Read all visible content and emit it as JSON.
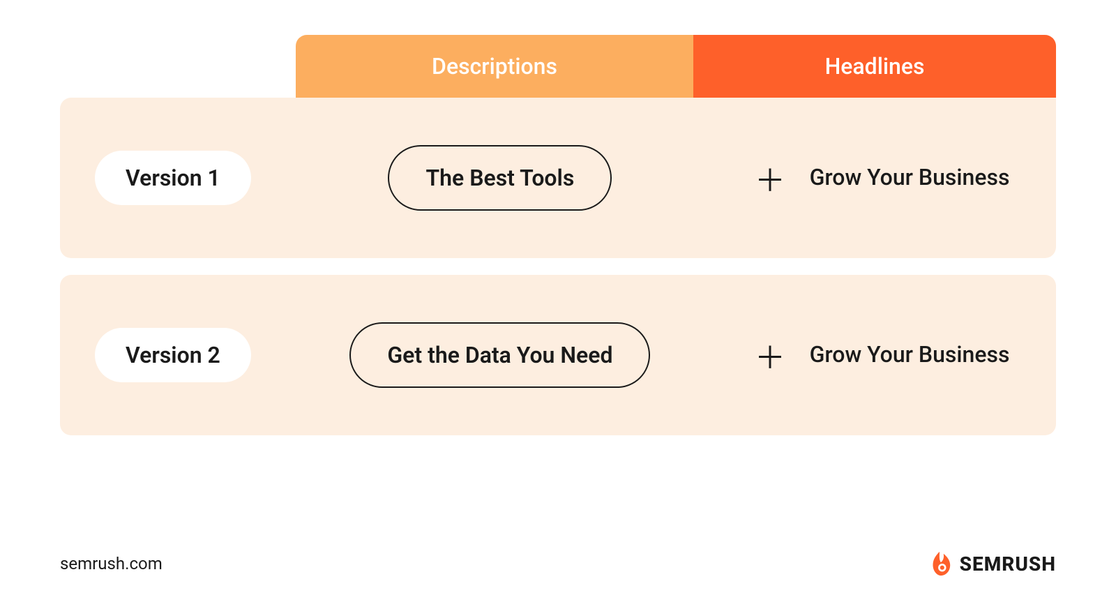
{
  "header": {
    "descriptions": "Descriptions",
    "headlines": "Headlines"
  },
  "rows": [
    {
      "version": "Version 1",
      "description": "The Best Tools",
      "plus": "＋",
      "headline": "Grow Your Business"
    },
    {
      "version": "Version 2",
      "description": "Get the Data You Need",
      "plus": "＋",
      "headline": "Grow Your Business"
    }
  ],
  "footer": {
    "url": "semrush.com",
    "brand": "SEMRUSH"
  },
  "colors": {
    "descriptions_bg": "#FCAE5F",
    "headlines_bg": "#FE602A",
    "row_bg": "#FDEEE0",
    "accent": "#FE602A"
  }
}
